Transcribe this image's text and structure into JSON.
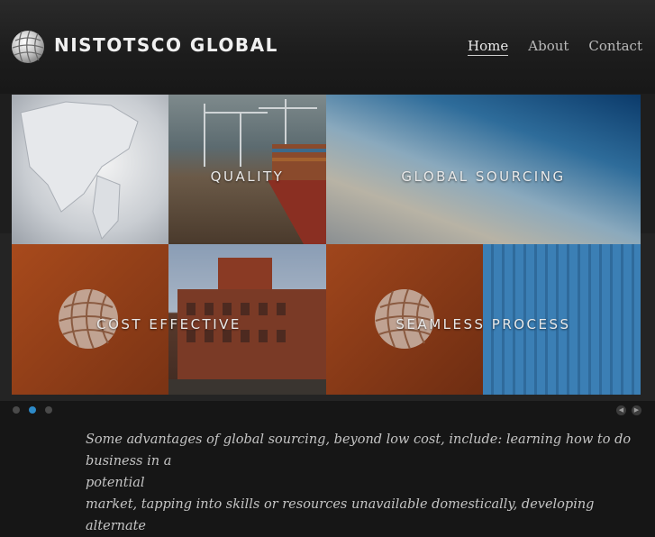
{
  "brand": {
    "name": "NISTOTSCO GLOBAL",
    "logo_icon": "globe-icon"
  },
  "nav": {
    "items": [
      "Home",
      "About",
      "Contact"
    ],
    "active": "Home"
  },
  "slider": {
    "tiles": {
      "quality": "QUALITY",
      "global_sourcing": "GLOBAL SOURCING",
      "cost_effective": "COST EFFECTIVE",
      "seamless_process": "SEAMLESS PROCESS"
    },
    "dots_count": 3,
    "active_dot": 2,
    "prev_icon": "chevron-left-icon",
    "next_icon": "chevron-right-icon"
  },
  "content": {
    "line1": "Some advantages of global sourcing, beyond low cost, include: learning how to do business in a",
    "line2": "potential",
    "line3": "market, tapping into skills or resources unavailable domestically, developing alternate"
  },
  "colors": {
    "accent_dot": "#2d8ac8",
    "background": "#161616"
  }
}
